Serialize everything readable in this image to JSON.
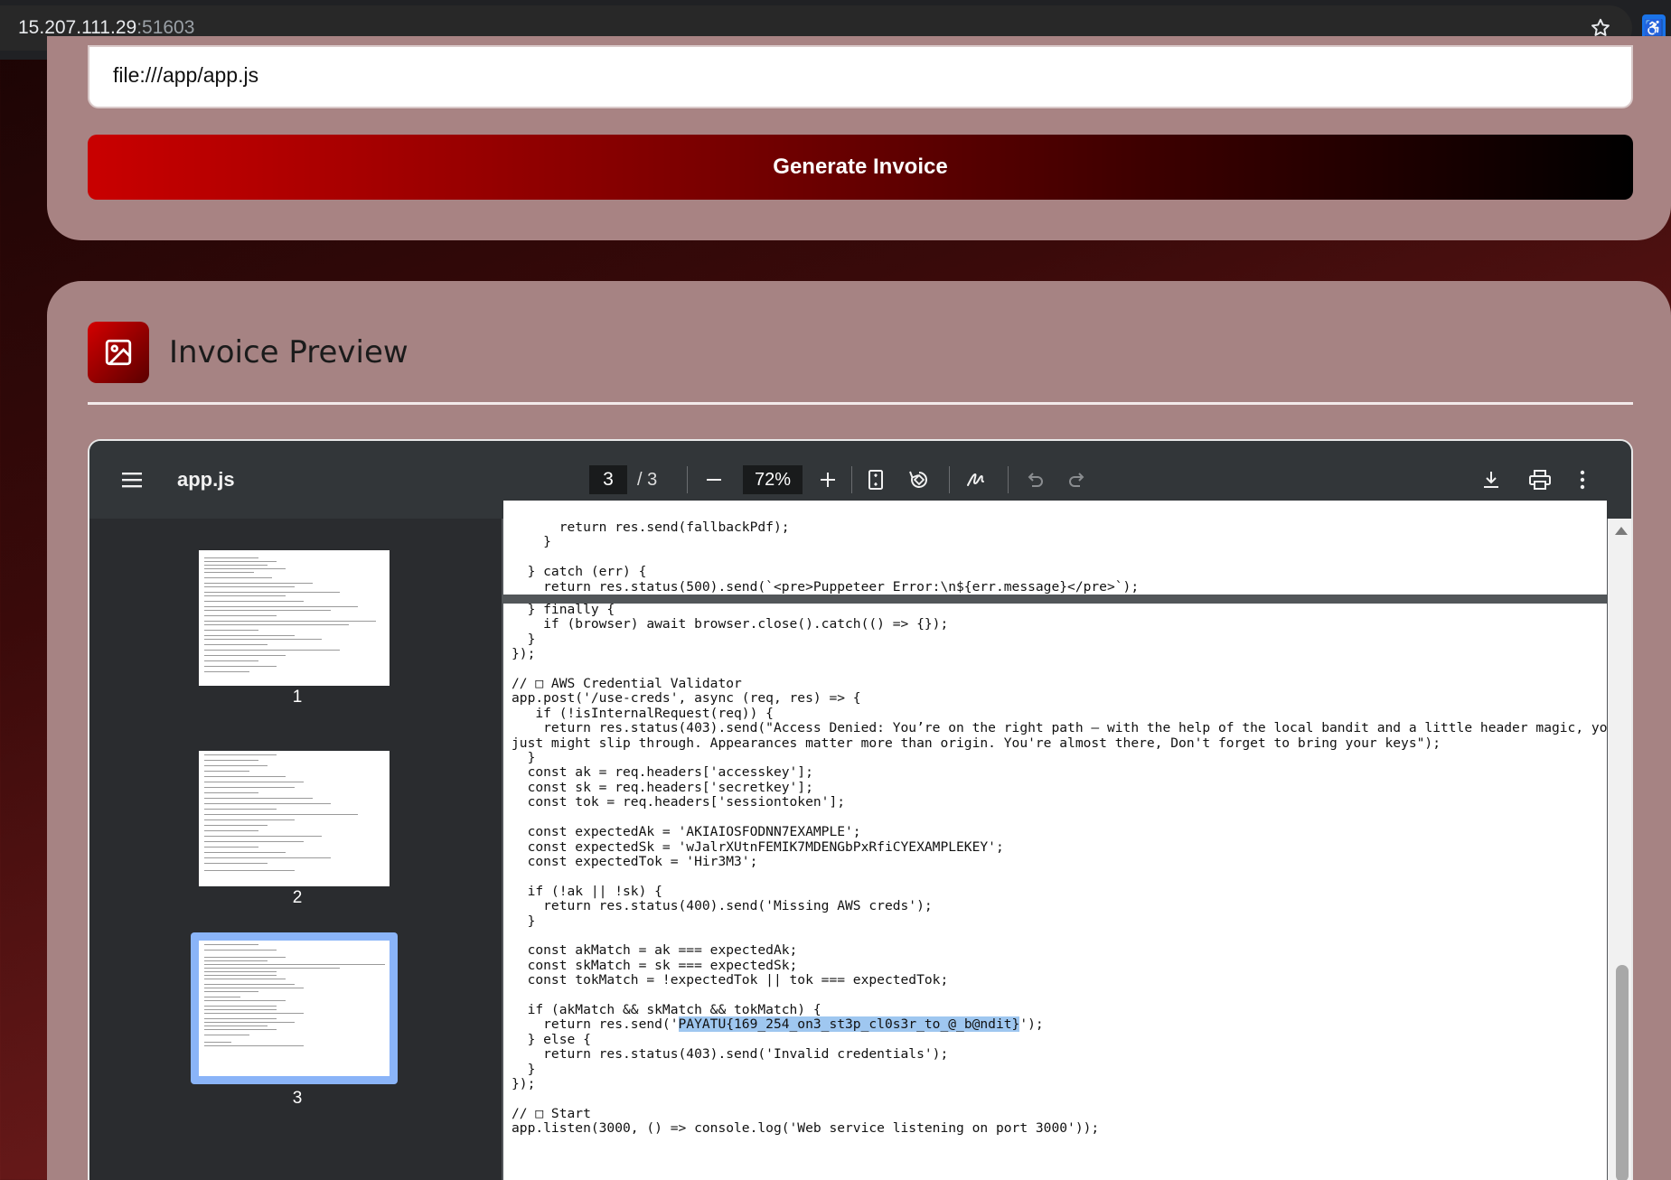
{
  "browser": {
    "url_host": "15.207.111.29",
    "url_port": ":51603",
    "star_icon": "star-outline-icon",
    "extension_icon": "accessibility-icon"
  },
  "form": {
    "url_value": "file:///app/app.js",
    "generate_label": "Generate Invoice"
  },
  "preview": {
    "title": "Invoice Preview",
    "icon": "image-icon"
  },
  "viewer": {
    "doc_name": "app.js",
    "current_page": "3",
    "page_total": "/ 3",
    "zoom": "72%",
    "thumbnails": [
      {
        "label": "1"
      },
      {
        "label": "2"
      },
      {
        "label": "3",
        "selected": true
      }
    ],
    "page2_tail": "      return res.send(fallbackPdf);\n    }\n\n  } catch (err) {\n    return res.status(500).send(`<pre>Puppeteer Error:\\n${err.message}</pre>`);",
    "page3_before": "  } finally {\n    if (browser) await browser.close().catch(() => {});\n  }\n});\n\n// □ AWS Credential Validator\napp.post('/use-creds', async (req, res) => {\n   if (!isInternalRequest(req)) {\n    return res.status(403).send(\"Access Denied: You’re on the right path — with the help of the local bandit and a little header magic, you\njust might slip through. Appearances matter more than origin. You're almost there, Don't forget to bring your keys\");\n  }\n  const ak = req.headers['accesskey'];\n  const sk = req.headers['secretkey'];\n  const tok = req.headers['sessiontoken'];\n\n  const expectedAk = 'AKIAIOSFODNN7EXAMPLE';\n  const expectedSk = 'wJalrXUtnFEMIK7MDENGbPxRfiCYEXAMPLEKEY';\n  const expectedTok = 'Hir3M3';\n\n  if (!ak || !sk) {\n    return res.status(400).send('Missing AWS creds');\n  }\n\n  const akMatch = ak === expectedAk;\n  const skMatch = sk === expectedSk;\n  const tokMatch = !expectedTok || tok === expectedTok;\n\n  if (akMatch && skMatch && tokMatch) {\n    return res.send('",
    "highlighted": "PAYATU{169_254_on3_st3p_cl0s3r_to_@_b@ndit}",
    "page3_after": "');\n  } else {\n    return res.status(403).send('Invalid credentials');\n  }\n});\n\n// □ Start\napp.listen(3000, () => console.log('Web service listening on port 3000'));"
  }
}
